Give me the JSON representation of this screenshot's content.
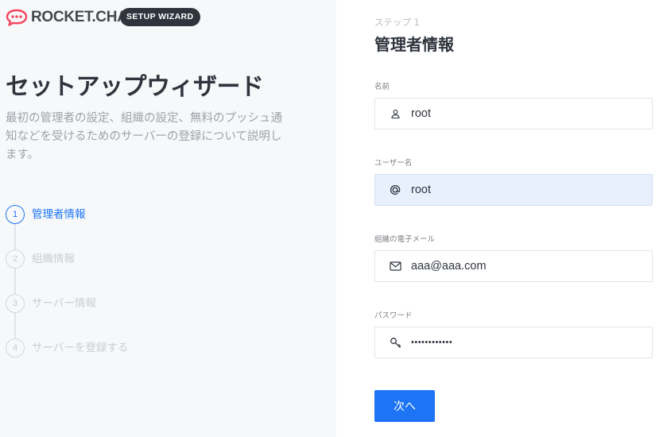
{
  "brand": {
    "logo_text": "ROCKET.CHAT",
    "badge": "SETUP WIZARD",
    "accent": "#f5455c"
  },
  "wizard": {
    "title": "セットアップウィザード",
    "description": "最初の管理者の設定、組織の設定、無料のプッシュ通知などを受けるためのサーバーの登録について説明します。",
    "steps": [
      {
        "num": "1",
        "label": "管理者情報",
        "active": true
      },
      {
        "num": "2",
        "label": "組織情報",
        "active": false
      },
      {
        "num": "3",
        "label": "サーバー情報",
        "active": false
      },
      {
        "num": "4",
        "label": "サーバーを登録する",
        "active": false
      }
    ]
  },
  "form": {
    "step_caption": "ステップ 1",
    "section_title": "管理者情報",
    "fields": {
      "name": {
        "label": "名前",
        "value": "root",
        "icon": "user-icon"
      },
      "username": {
        "label": "ユーザー名",
        "value": "root",
        "icon": "at-icon"
      },
      "email": {
        "label": "組織の電子メール",
        "value": "aaa@aaa.com",
        "icon": "mail-icon"
      },
      "password": {
        "label": "パスワード",
        "value": "••••••••••••",
        "icon": "key-icon"
      }
    },
    "next_label": "次へ"
  },
  "colors": {
    "primary": "#1d74f5",
    "dark": "#2f343d",
    "muted": "#9ea2a8"
  }
}
